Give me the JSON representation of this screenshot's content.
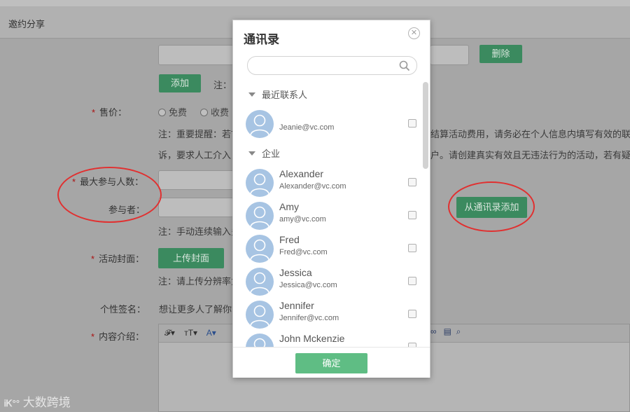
{
  "header": {
    "title": "邀约分享"
  },
  "form": {
    "delete_label": "删除",
    "add_label": "添加",
    "add_note": "注：",
    "price_label": "售价：",
    "price_free": "免费",
    "price_paid": "收费",
    "price_note_1": "注：重要提醒：若7",
    "price_note_1_tail": "结算活动费用，请务必在个人信息内填写有效的联系方",
    "price_note_2": "诉，要求人工介入，",
    "price_note_2_tail": "户。请创建真实有效且无违法行为的活动，若有疑问联",
    "max_participants_label": "最大参与人数：",
    "participants_label": "参与者：",
    "add_from_contacts_label": "从通讯录添加",
    "participants_note": "注：手动连续输入多",
    "cover_label": "活动封面：",
    "upload_cover_label": "上传封面",
    "cover_note": "注：请上传分辨率为",
    "signature_label": "个性签名：",
    "signature_value": "想让更多人了解你",
    "intro_label": "内容介绍："
  },
  "editor_toolbar": {
    "font": "𝓕▾",
    "size": "тT▾",
    "color": "A▾"
  },
  "modal": {
    "title": "通讯录",
    "search_placeholder": "",
    "recent_group": "最近联系人",
    "company_group": "企业",
    "recent": [
      {
        "name": "",
        "email": "Jeanie@vc.com"
      }
    ],
    "contacts": [
      {
        "name": "Alexander",
        "email": "Alexander@vc.com"
      },
      {
        "name": "Amy",
        "email": "amy@vc.com"
      },
      {
        "name": "Fred",
        "email": "Fred@vc.com"
      },
      {
        "name": "Jessica",
        "email": "Jessica@vc.com"
      },
      {
        "name": "Jennifer",
        "email": "Jennifer@vc.com"
      },
      {
        "name": "John Mckenzie",
        "email": ""
      }
    ],
    "confirm_label": "确定"
  },
  "watermark": "大数跨境",
  "colors": {
    "accent_green": "#5fbd84",
    "dim_green": "#3b8a5f",
    "highlight_red": "#e13030",
    "avatar_blue": "#a7c4e3"
  }
}
